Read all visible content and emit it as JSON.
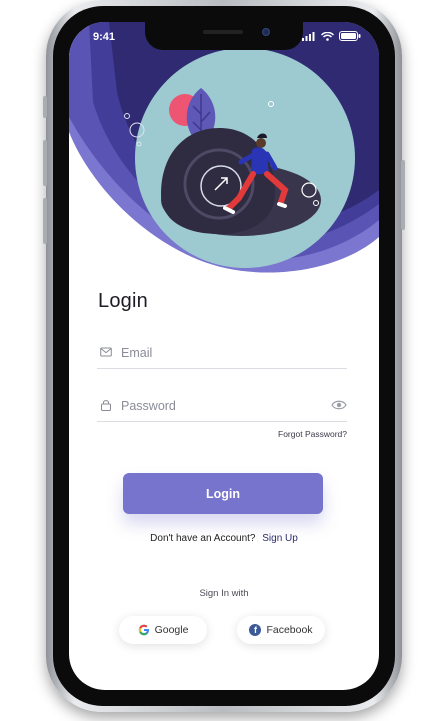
{
  "status_bar": {
    "time": "9:41"
  },
  "login": {
    "title": "Login",
    "email_placeholder": "Email",
    "password_placeholder": "Password",
    "forgot_password": "Forgot Password?",
    "login_button": "Login",
    "no_account_text": "Don't have an Account?",
    "sign_up_link": "Sign Up",
    "sign_in_with": "Sign In with",
    "google_label": "Google",
    "facebook_label": "Facebook"
  },
  "icons": {
    "email": "mail-icon",
    "password": "lock-icon",
    "show_password": "eye-icon",
    "google": "google-icon",
    "facebook": "facebook-icon"
  },
  "colors": {
    "accent": "#7674cc",
    "header_dark": "#2f2a6b",
    "header_mid": "#5c55b3",
    "circle_teal": "#9ccad0",
    "link": "#2d2d6e"
  }
}
